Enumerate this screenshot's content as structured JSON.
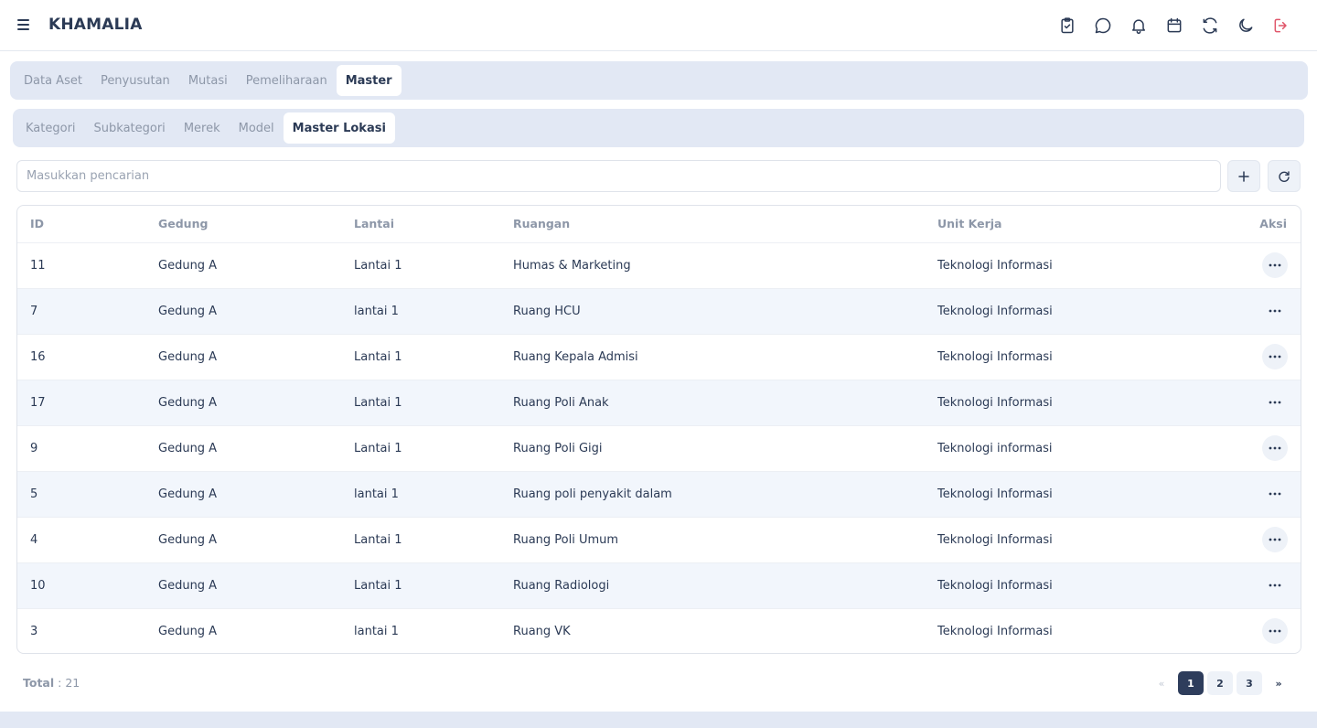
{
  "app": {
    "title": "KHAMALIA"
  },
  "header_icons": [
    "clipboard-check-icon",
    "chat-icon",
    "bell-icon",
    "calendar-icon",
    "refresh-icon",
    "moon-icon",
    "logout-icon"
  ],
  "main_tabs": [
    {
      "label": "Data Aset",
      "active": false
    },
    {
      "label": "Penyusutan",
      "active": false
    },
    {
      "label": "Mutasi",
      "active": false
    },
    {
      "label": "Pemeliharaan",
      "active": false
    },
    {
      "label": "Master",
      "active": true
    }
  ],
  "sub_tabs": [
    {
      "label": "Kategori",
      "active": false
    },
    {
      "label": "Subkategori",
      "active": false
    },
    {
      "label": "Merek",
      "active": false
    },
    {
      "label": "Model",
      "active": false
    },
    {
      "label": "Master Lokasi",
      "active": true
    }
  ],
  "search": {
    "placeholder": "Masukkan pencarian",
    "value": ""
  },
  "table": {
    "columns": [
      "ID",
      "Gedung",
      "Lantai",
      "Ruangan",
      "Unit Kerja",
      "Aksi"
    ],
    "rows": [
      [
        "11",
        "Gedung A",
        "Lantai 1",
        "Humas & Marketing",
        "Teknologi Informasi"
      ],
      [
        "7",
        "Gedung A",
        "lantai 1",
        "Ruang HCU",
        "Teknologi Informasi"
      ],
      [
        "16",
        "Gedung A",
        "Lantai 1",
        "Ruang Kepala Admisi",
        "Teknologi Informasi"
      ],
      [
        "17",
        "Gedung A",
        "Lantai 1",
        "Ruang Poli Anak",
        "Teknologi Informasi"
      ],
      [
        "9",
        "Gedung A",
        "Lantai 1",
        "Ruang Poli Gigi",
        "Teknologi informasi"
      ],
      [
        "5",
        "Gedung A",
        "lantai 1",
        "Ruang poli penyakit dalam",
        "Teknologi Informasi"
      ],
      [
        "4",
        "Gedung A",
        "Lantai 1",
        "Ruang Poli Umum",
        "Teknologi Informasi"
      ],
      [
        "10",
        "Gedung A",
        "Lantai 1",
        "Ruang Radiologi",
        "Teknologi Informasi"
      ],
      [
        "3",
        "Gedung A",
        "lantai 1",
        "Ruang VK",
        "Teknologi Informasi"
      ]
    ]
  },
  "footer": {
    "total_label": "Total",
    "total_value": " : 21",
    "pagination": {
      "prev": "«",
      "pages": [
        "1",
        "2",
        "3"
      ],
      "current": "1",
      "next": "»"
    }
  },
  "colors": {
    "primary": "#2e3d5c",
    "tab_bg": "#e2e8f4",
    "logout": "#e0566a"
  }
}
